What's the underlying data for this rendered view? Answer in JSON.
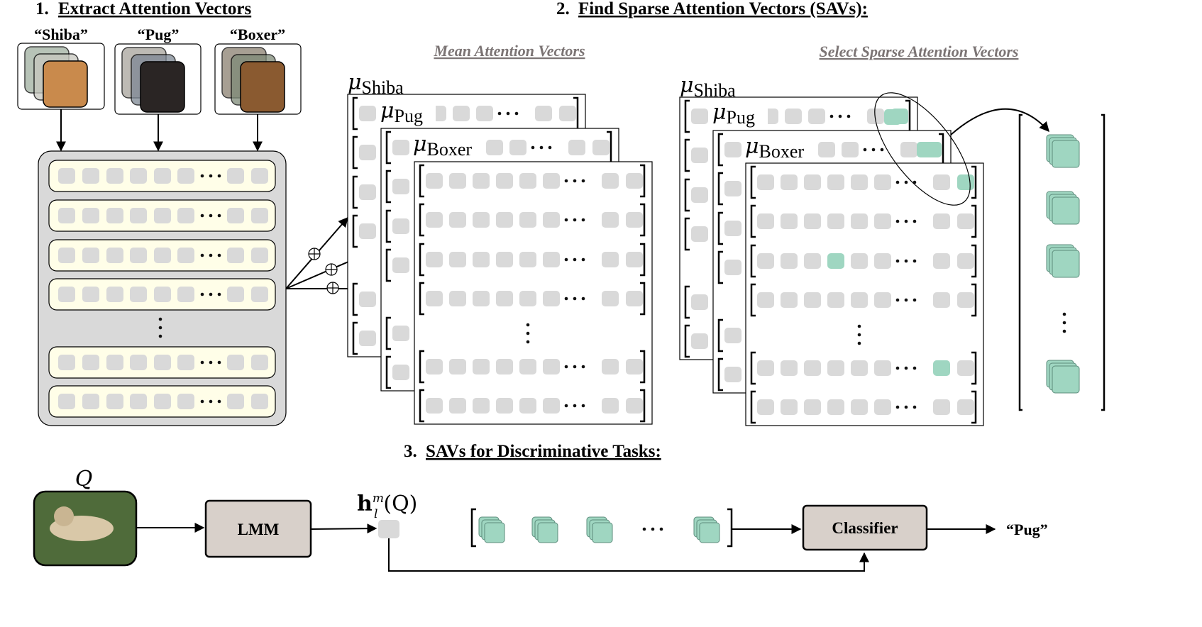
{
  "section1": {
    "number": "1.",
    "title": "Extract Attention Vectors"
  },
  "section2": {
    "number": "2.",
    "title": "Find Sparse Attention Vectors (SAVs):"
  },
  "section3": {
    "number": "3.",
    "title": "SAVs for Discriminative Tasks:"
  },
  "subtitles": {
    "mean": "Mean Attention Vectors",
    "select": "Select Sparse Attention Vectors"
  },
  "classes": [
    "“Shiba”",
    "“Pug”",
    "“Boxer”"
  ],
  "mu": {
    "symbol": "μ",
    "subscripts": [
      "Shiba",
      "Pug",
      "Boxer"
    ]
  },
  "ellipsis": "···",
  "query": {
    "label": "Q",
    "h_symbol": "h",
    "h_sup": "m",
    "h_sub": "l",
    "h_arg": "(Q)"
  },
  "boxes": {
    "model": "LMM",
    "classifier": "Classifier"
  },
  "output": "“Pug”",
  "colors": {
    "cell": "#d9d9d9",
    "sav": "#9fd6c1",
    "row_fill": "#fffee8",
    "panel": "#d9d9d9",
    "box_fill": "#d8d0ca",
    "subtitle": "#7b7474"
  },
  "icons": {
    "sum": "circled-plus-icon",
    "photo": "dog-photo"
  }
}
